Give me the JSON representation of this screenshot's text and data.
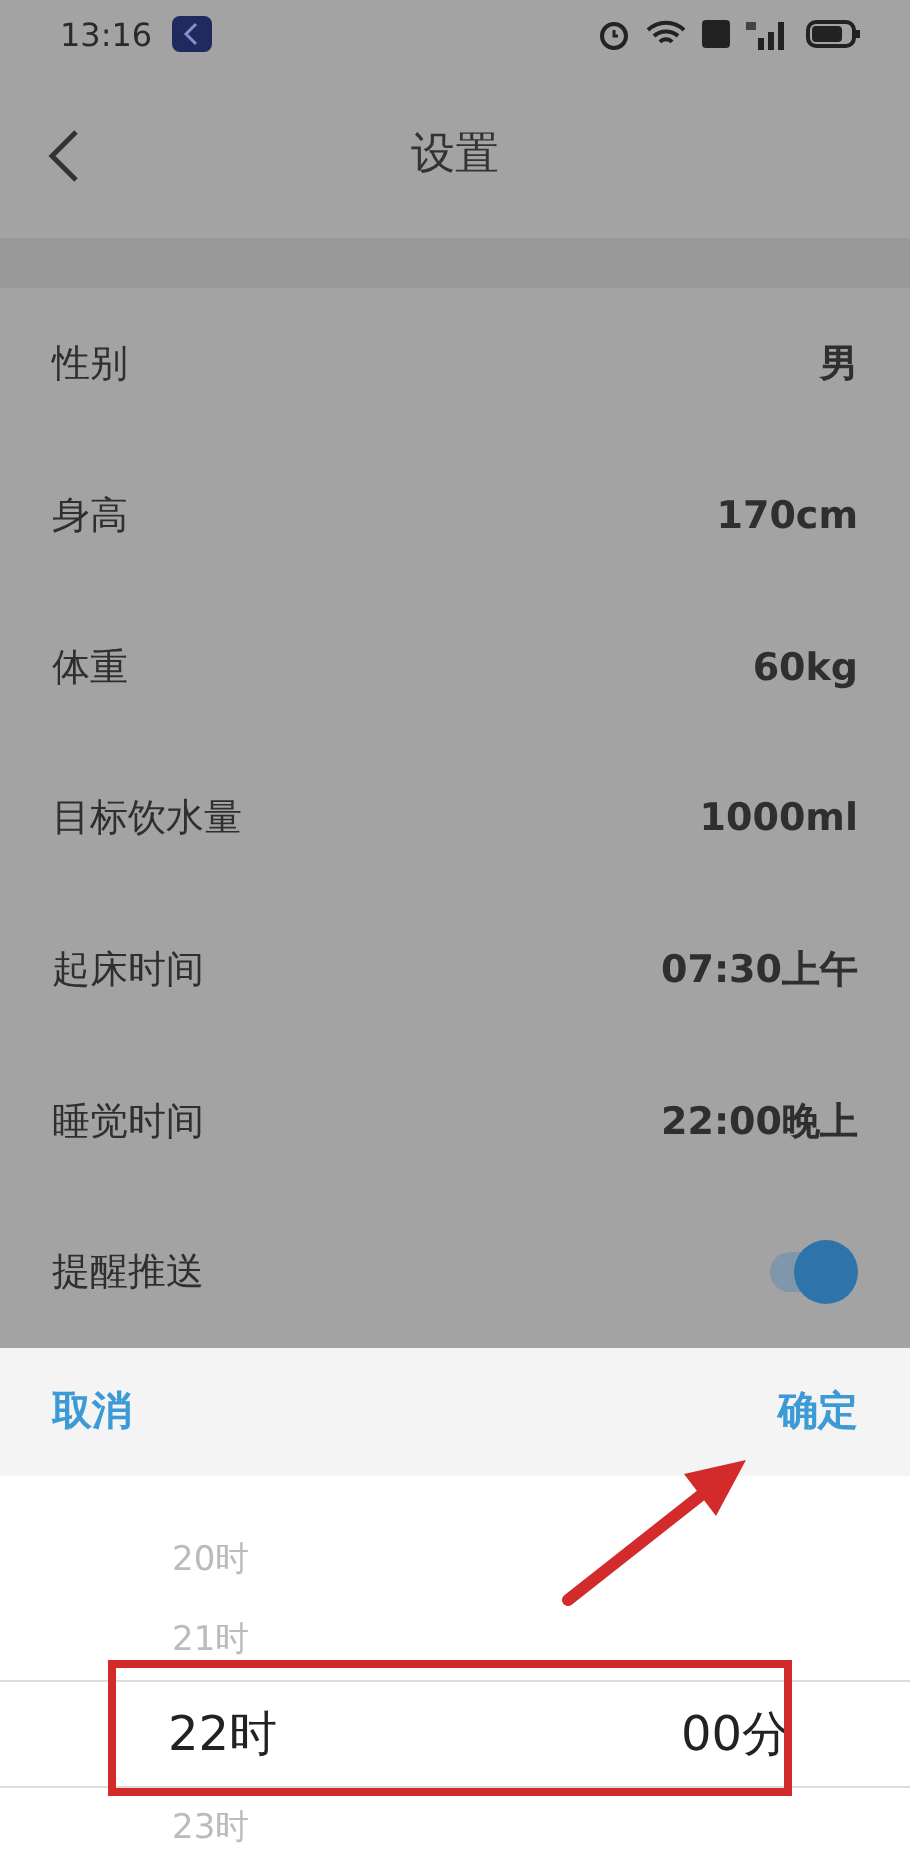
{
  "status_bar": {
    "time": "13:16"
  },
  "header": {
    "title": "设置"
  },
  "settings": [
    {
      "label": "性别",
      "kind": "value",
      "value": "男"
    },
    {
      "label": "身高",
      "kind": "value",
      "value": "170cm"
    },
    {
      "label": "体重",
      "kind": "value",
      "value": "60kg"
    },
    {
      "label": "目标饮水量",
      "kind": "value",
      "value": "1000ml"
    },
    {
      "label": "起床时间",
      "kind": "value",
      "value": "07:30上午"
    },
    {
      "label": "睡觉时间",
      "kind": "value",
      "value": "22:00晚上"
    },
    {
      "label": "提醒推送",
      "kind": "toggle",
      "on": true
    }
  ],
  "picker": {
    "cancel": "取消",
    "confirm": "确定",
    "hours": [
      {
        "label": "20时",
        "selected": false
      },
      {
        "label": "21时",
        "selected": false
      },
      {
        "label": "22时",
        "selected": true
      },
      {
        "label": "23时",
        "selected": false
      }
    ],
    "minute": "00分"
  }
}
